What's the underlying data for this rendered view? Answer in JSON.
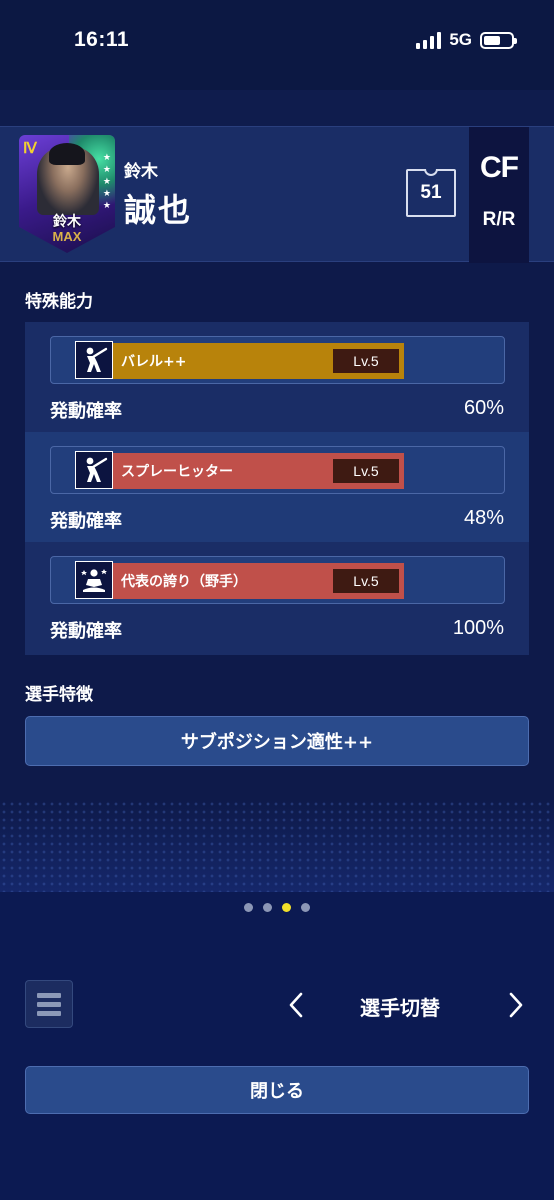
{
  "status_bar": {
    "time": "16:11",
    "network": "5G"
  },
  "player": {
    "card_level": "Ⅳ",
    "card_name": "鈴木",
    "card_grade": "MAX",
    "last_name": "鈴木",
    "first_name": "誠也",
    "number": "51",
    "position": "CF",
    "bat_throw": "R/R"
  },
  "special_abilities": {
    "title": "特殊能力",
    "items": [
      {
        "name": "バレル++",
        "level": "Lv.5",
        "prob_label": "発動確率",
        "prob_value": "60%",
        "color": "#b8830b",
        "icon": "batter-icon"
      },
      {
        "name": "スプレーヒッター",
        "level": "Lv.5",
        "prob_label": "発動確率",
        "prob_value": "48%",
        "color": "#c0504a",
        "icon": "batter-icon"
      },
      {
        "name": "代表の誇り（野手）",
        "level": "Lv.5",
        "prob_label": "発動確率",
        "prob_value": "100%",
        "color": "#c0504a",
        "icon": "meditation-icon"
      }
    ]
  },
  "player_traits": {
    "title": "選手特徴",
    "button_label": "サブポジション適性++"
  },
  "pager": {
    "count": 4,
    "active_index": 2
  },
  "nav": {
    "switch_label": "選手切替"
  },
  "close_label": "閉じる",
  "colors": {
    "background": "#0e1a4a",
    "panel": "#1a2d66",
    "button": "#2a4b8c",
    "accent_dot": "#f2e02a"
  }
}
